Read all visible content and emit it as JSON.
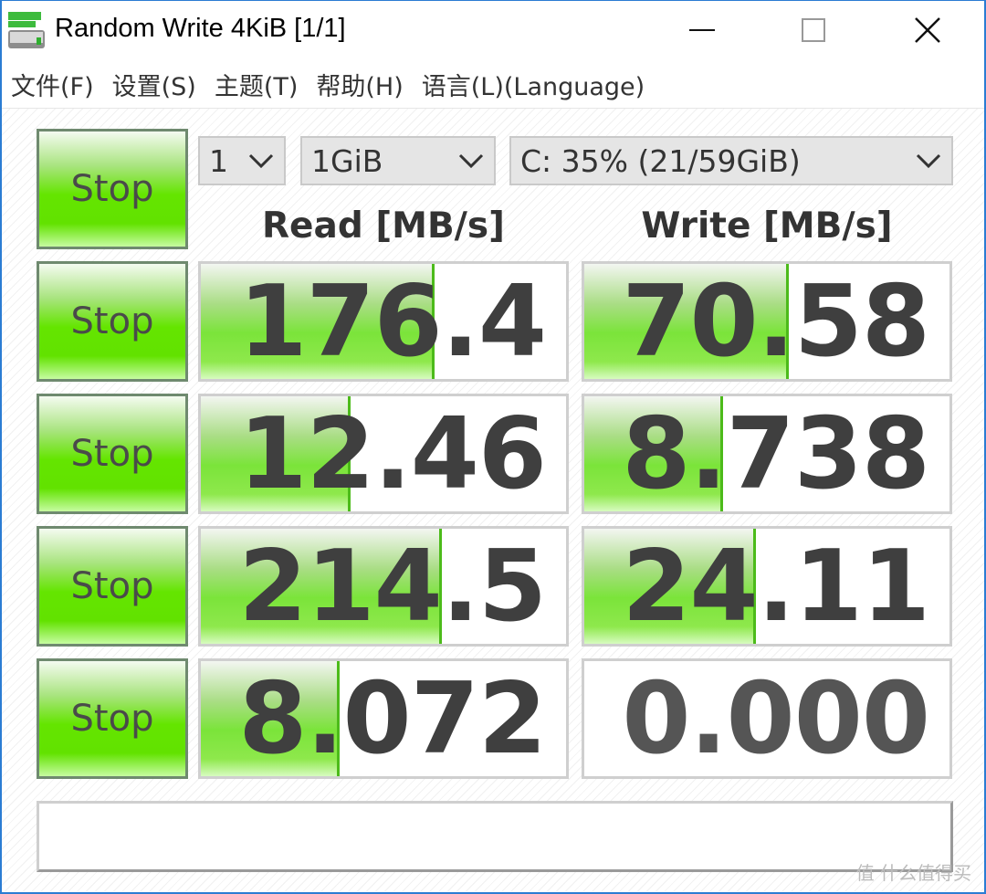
{
  "window": {
    "title": "Random Write 4KiB [1/1]",
    "minimize_icon": "minimize-icon",
    "maximize_icon": "maximize-icon",
    "close_icon": "close-icon"
  },
  "menu": [
    "文件(F)",
    "设置(S)",
    "主题(T)",
    "帮助(H)",
    "语言(L)(Language)"
  ],
  "controls": {
    "count": "1",
    "size": "1GiB",
    "drive": "C: 35% (21/59GiB)",
    "all_button": "Stop"
  },
  "headers": {
    "read": "Read [MB/s]",
    "write": "Write [MB/s]"
  },
  "rows": [
    {
      "button": "Stop",
      "read": "176.4",
      "write": "70.58",
      "read_fill": 0.64,
      "write_fill": 0.56
    },
    {
      "button": "Stop",
      "read": "12.46",
      "write": "8.738",
      "read_fill": 0.41,
      "write_fill": 0.38
    },
    {
      "button": "Stop",
      "read": "214.5",
      "write": "24.11",
      "read_fill": 0.66,
      "write_fill": 0.47
    },
    {
      "button": "Stop",
      "read": "8.072",
      "write": "0.000",
      "read_fill": 0.38,
      "write_fill": 0
    }
  ],
  "status": "",
  "watermark": "值 什么值得买",
  "colors": {
    "accent_green": "#64e500",
    "window_border": "#2b7cd3",
    "value_text": "#3f3f3f"
  }
}
